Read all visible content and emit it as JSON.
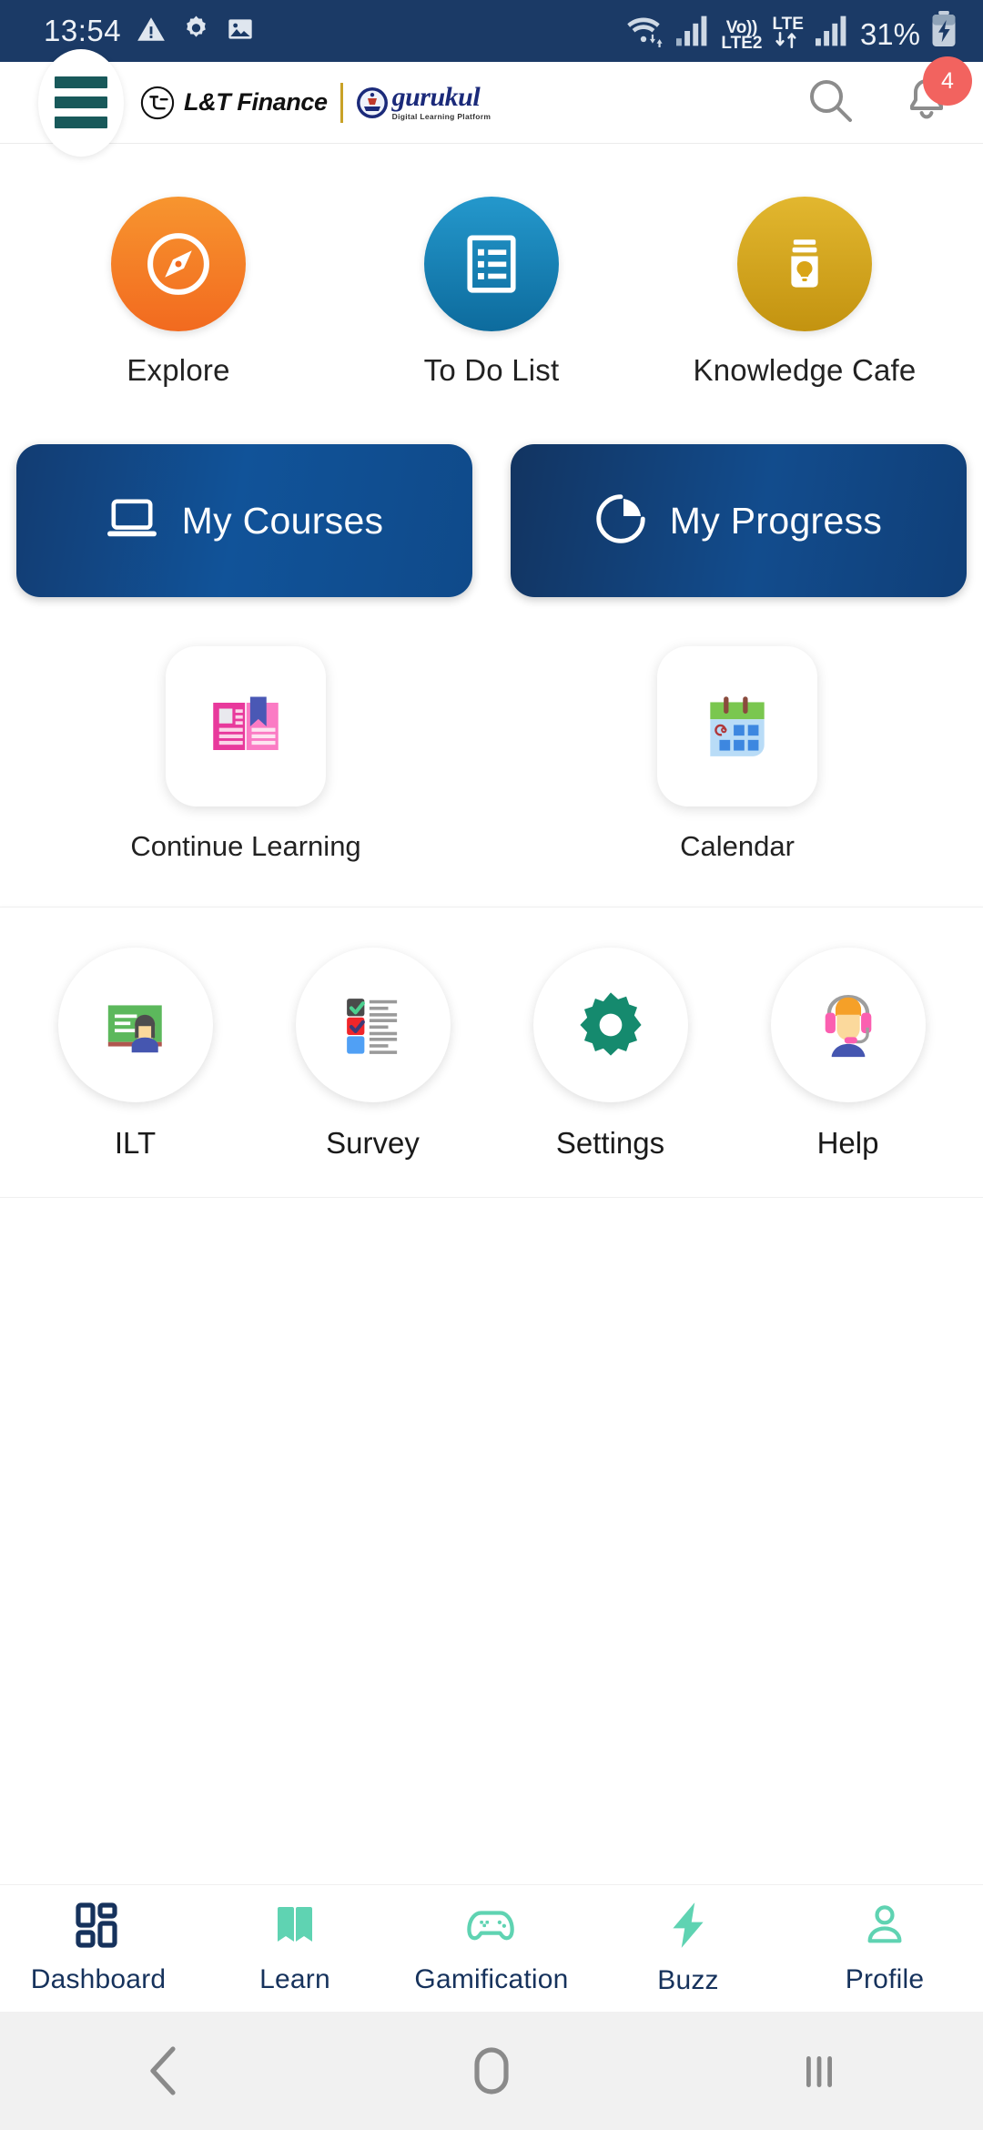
{
  "status_bar": {
    "time": "13:54",
    "battery_percent": "31%",
    "volte_label_top": "Vo))",
    "volte_label_bottom": "LTE2",
    "lte_label": "LTE",
    "icons": [
      "warning-triangle-icon",
      "gear-icon",
      "image-icon",
      "wifi-icon",
      "signal-bars-icon",
      "volte-icon",
      "lte-icon",
      "signal-bars-icon",
      "battery-charging-icon"
    ]
  },
  "header": {
    "menu_icon": "hamburger-menu-icon",
    "brand_primary": "L&T Finance",
    "brand_secondary": "gurukul",
    "brand_tagline": "Digital Learning Platform",
    "search_icon": "search-icon",
    "bell_icon": "notification-bell-icon",
    "notification_count": "4",
    "badge_color": "#f2635f",
    "menu_color": "#18595a"
  },
  "shortcuts": [
    {
      "label": "Explore",
      "icon": "compass-icon",
      "color_top": "#f7952f",
      "color_bottom": "#f26a1f"
    },
    {
      "label": "To Do List",
      "icon": "checklist-icon",
      "color_top": "#2498cc",
      "color_bottom": "#0d6b9d"
    },
    {
      "label": "Knowledge Cafe",
      "icon": "lightbulb-jar-icon",
      "color_top": "#e2b72f",
      "color_bottom": "#c39310"
    }
  ],
  "primary_buttons": [
    {
      "label": "My Courses",
      "icon": "laptop-icon"
    },
    {
      "label": "My Progress",
      "icon": "pie-chart-icon"
    }
  ],
  "feature_cards": [
    {
      "label": "Continue Learning",
      "icon": "open-book-bookmark-icon"
    },
    {
      "label": "Calendar",
      "icon": "calendar-icon"
    }
  ],
  "utilities": [
    {
      "label": "ILT",
      "icon": "instructor-board-icon"
    },
    {
      "label": "Survey",
      "icon": "survey-checklist-icon"
    },
    {
      "label": "Settings",
      "icon": "gear-icon",
      "color": "#158a6e"
    },
    {
      "label": "Help",
      "icon": "support-headset-icon"
    }
  ],
  "bottom_nav": {
    "active": "Dashboard",
    "active_color": "#16325c",
    "inactive_color": "#5fd3b2",
    "items": [
      {
        "label": "Dashboard",
        "icon": "dashboard-grid-icon"
      },
      {
        "label": "Learn",
        "icon": "open-book-icon"
      },
      {
        "label": "Gamification",
        "icon": "gamepad-icon"
      },
      {
        "label": "Buzz",
        "icon": "lightning-bolt-icon"
      },
      {
        "label": "Profile",
        "icon": "person-icon"
      }
    ]
  },
  "android_nav": {
    "back": "back-chevron-icon",
    "home": "home-circle-icon",
    "recents": "recents-bars-icon"
  }
}
